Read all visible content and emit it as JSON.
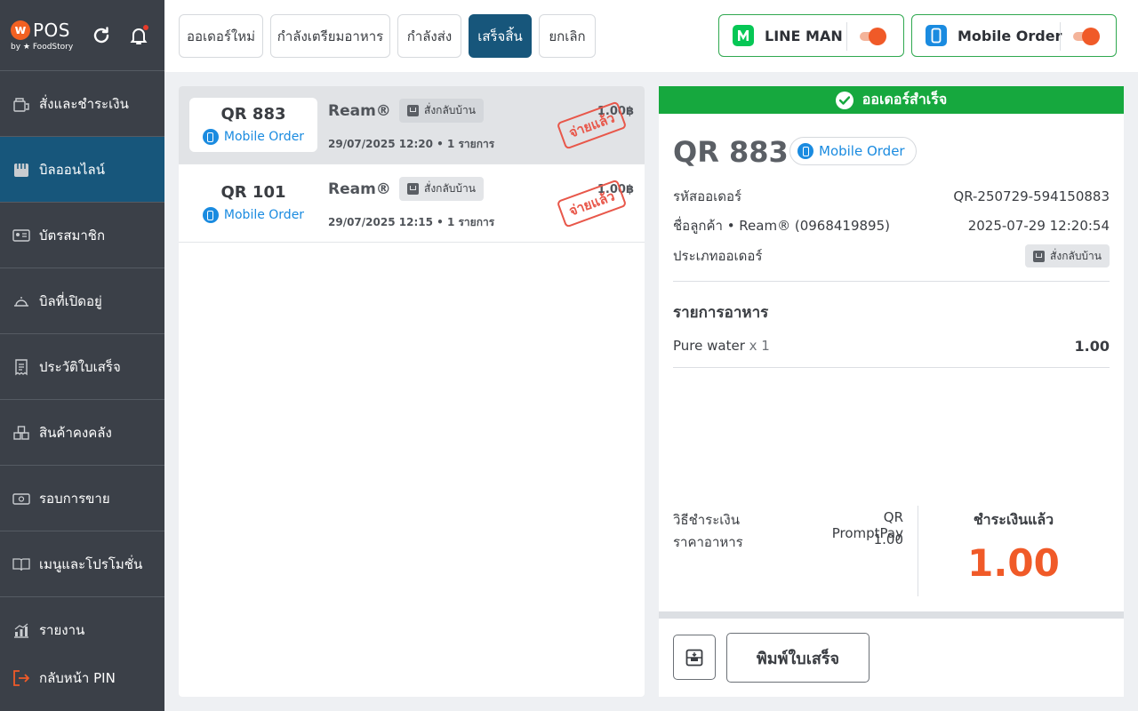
{
  "app": {
    "logo_letter": "w",
    "logo_text": "POS",
    "logo_sub": "by ★ FoodStory"
  },
  "sidebar": {
    "items": [
      {
        "label": "สั่งและชำระเงิน",
        "icon": "order-pay-icon"
      },
      {
        "label": "บิลออนไลน์",
        "icon": "online-bill-icon",
        "active": true
      },
      {
        "label": "บัตรสมาชิก",
        "icon": "member-card-icon"
      },
      {
        "label": "บิลที่เปิดอยู่",
        "icon": "open-bill-icon"
      },
      {
        "label": "ประวัติใบเสร็จ",
        "icon": "receipt-history-icon"
      },
      {
        "label": "สินค้าคงคลัง",
        "icon": "inventory-icon"
      },
      {
        "label": "รอบการขาย",
        "icon": "sales-round-icon"
      },
      {
        "label": "เมนูและโปรโมชั่น",
        "icon": "menu-book-icon"
      },
      {
        "label": "รายงาน",
        "icon": "report-chart-icon"
      }
    ],
    "logout_label": "กลับหน้า PIN"
  },
  "tabs": [
    {
      "label": "ออเดอร์ใหม่",
      "active": false
    },
    {
      "label": "กำลังเตรียมอาหาร",
      "active": false
    },
    {
      "label": "กำลังส่ง",
      "active": false
    },
    {
      "label": "เสร็จสิ้น",
      "active": true
    },
    {
      "label": "ยกเลิก",
      "active": false
    }
  ],
  "channels": [
    {
      "name": "LINE MAN",
      "enabled": true,
      "color": "#06c755"
    },
    {
      "name": "Mobile Order",
      "enabled": true,
      "color": "#1a8be0"
    }
  ],
  "orders": [
    {
      "qr": "QR 883",
      "channel": "Mobile Order",
      "customer": "Ream®",
      "type": "สั่งกลับบ้าน",
      "meta": "29/07/2025 12:20 • 1 รายการ",
      "amount": "1.00฿",
      "stamp": "จ่ายแล้ว",
      "selected": true
    },
    {
      "qr": "QR 101",
      "channel": "Mobile Order",
      "customer": "Ream®",
      "type": "สั่งกลับบ้าน",
      "meta": "29/07/2025 12:15 • 1 รายการ",
      "amount": "1.00฿",
      "stamp": "จ่ายแล้ว",
      "selected": false
    }
  ],
  "detail": {
    "status": "ออเดอร์สำเร็จ",
    "qr": "QR 883",
    "channel": "Mobile Order",
    "order_id_label": "รหัสออเดอร์",
    "order_id": "QR-250729-594150883",
    "customer_label": "ชื่อลูกค้า • Ream® (0968419895)",
    "datetime": "2025-07-29 12:20:54",
    "order_type_label": "ประเภทออเดอร์",
    "order_type": "สั่งกลับบ้าน",
    "items_title": "รายการอาหาร",
    "items": [
      {
        "name": "Pure water",
        "qty": "x 1",
        "price": "1.00"
      }
    ],
    "payment_method_label": "วิธีชำระเงิน",
    "payment_method": "QR PromptPay",
    "food_price_label": "ราคาอาหาร",
    "food_price": "1.00",
    "paid_title": "ชำระเงินแล้ว",
    "paid_amount": "1.00",
    "print_label": "พิมพ์ใบเสร็จ"
  },
  "colors": {
    "accent": "#17567b",
    "orange": "#f05a28",
    "success": "#16a83e",
    "link": "#1a8be0"
  }
}
